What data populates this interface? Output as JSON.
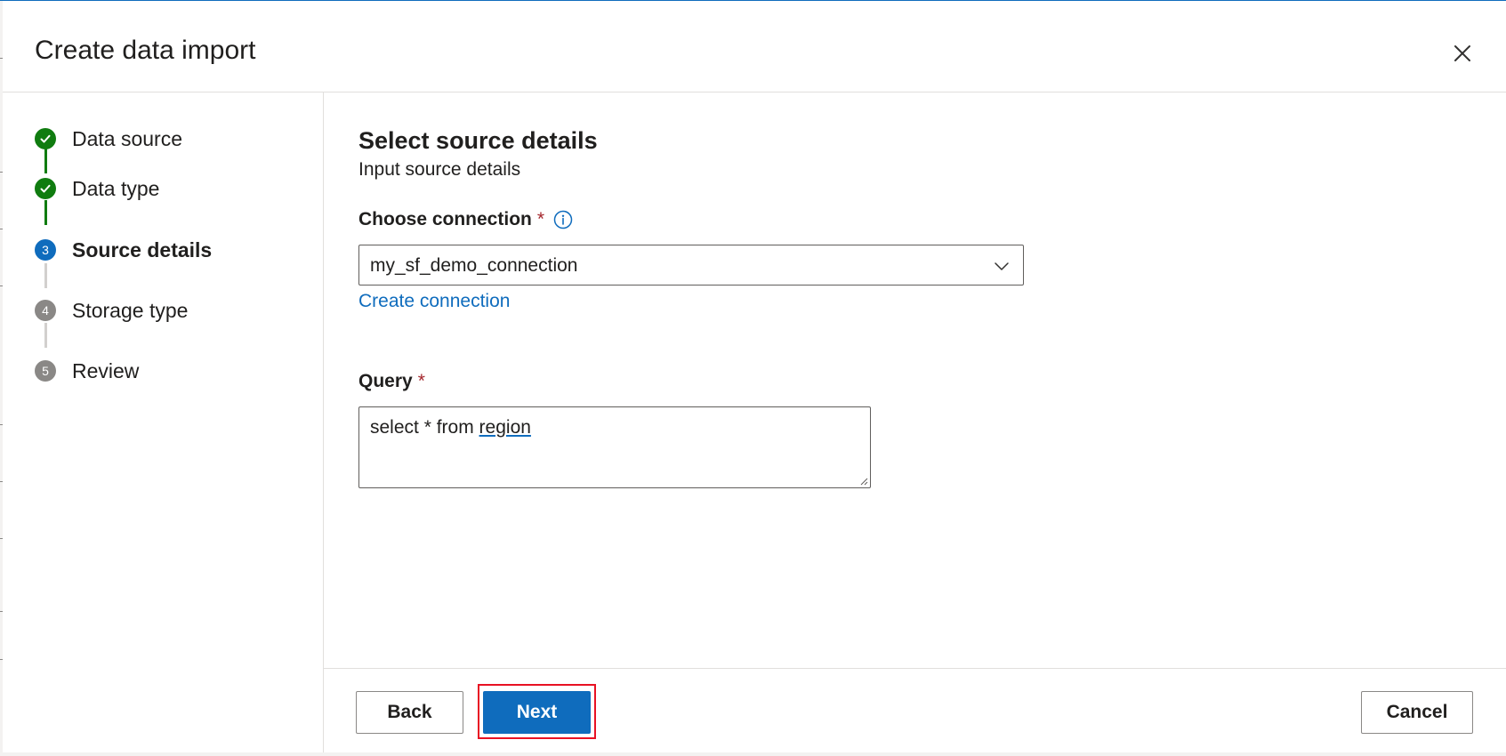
{
  "dialog": {
    "title": "Create data import",
    "close_icon": "close-icon"
  },
  "stepper": {
    "steps": [
      {
        "number": "1",
        "label": "Data source",
        "state": "completed"
      },
      {
        "number": "2",
        "label": "Data type",
        "state": "completed"
      },
      {
        "number": "3",
        "label": "Source details",
        "state": "current"
      },
      {
        "number": "4",
        "label": "Storage type",
        "state": "pending"
      },
      {
        "number": "5",
        "label": "Review",
        "state": "pending"
      }
    ],
    "completed_icon": "checkmark-icon"
  },
  "content": {
    "title": "Select source details",
    "subtitle": "Input source details",
    "connection": {
      "label": "Choose connection",
      "required_mark": "*",
      "info_icon": "info-icon",
      "value": "my_sf_demo_connection",
      "chevron_icon": "chevron-down-icon",
      "create_link": "Create connection"
    },
    "query": {
      "label": "Query",
      "required_mark": "*",
      "value_prefix": "select * from ",
      "value_word": "region"
    }
  },
  "footer": {
    "back_label": "Back",
    "next_label": "Next",
    "cancel_label": "Cancel"
  },
  "colors": {
    "accent": "#0f6cbd",
    "success": "#107c10",
    "pending": "#8a8886",
    "required": "#a4262c",
    "highlight": "#e81123"
  }
}
